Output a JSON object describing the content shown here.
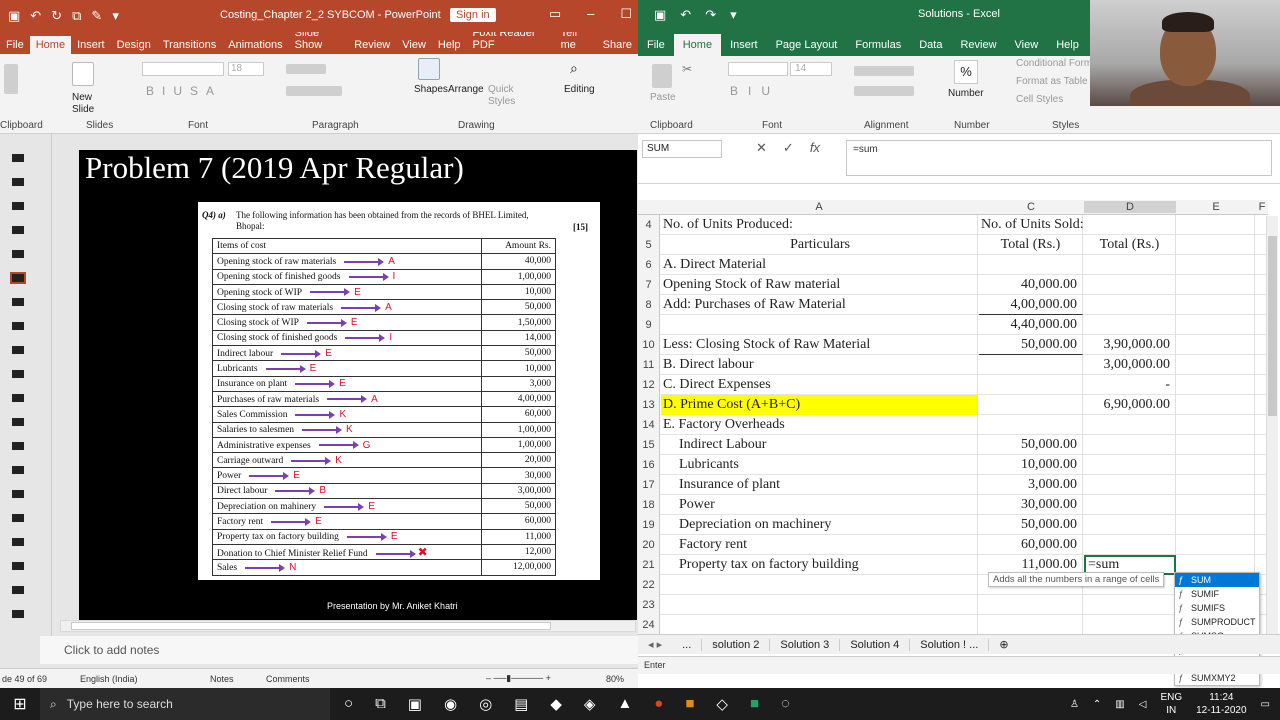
{
  "ppt": {
    "title": "Costing_Chapter 2_2 SYBCOM  -  PowerPoint",
    "signin": "Sign in",
    "tabs": [
      "File",
      "Home",
      "Insert",
      "Design",
      "Transitions",
      "Animations",
      "Slide Show",
      "Review",
      "View",
      "Help",
      "Foxit Reader PDF",
      "Tell me",
      "Share"
    ],
    "groups": [
      "Clipboard",
      "Slides",
      "Font",
      "Paragraph",
      "Drawing"
    ],
    "ribbon": {
      "new_slide": "New Slide",
      "shapes": "Shapes",
      "arrange": "Arrange",
      "quick_styles": "Quick Styles",
      "editing": "Editing",
      "font_size": "18"
    },
    "slide": {
      "title": "Problem 7 (2019 Apr Regular)",
      "question_tag": "Q4)  a)",
      "question_text": "The following information has been obtained from the records of BHEL Limited, Bhopal:",
      "marks": "[15]",
      "table_header": [
        "Items of cost",
        "Amount Rs."
      ],
      "rows": [
        {
          "item": "Opening stock of raw materials",
          "amount": "40,000",
          "cat": "A"
        },
        {
          "item": "Opening stock of finished goods",
          "amount": "1,00,000",
          "cat": "I"
        },
        {
          "item": "Opening stock of WIP",
          "amount": "10,000",
          "cat": "E"
        },
        {
          "item": "Closing stock of raw materials",
          "amount": "50,000",
          "cat": "A"
        },
        {
          "item": "Closing stock of WIP",
          "amount": "1,50,000",
          "cat": "E"
        },
        {
          "item": "Closing stock of finished goods",
          "amount": "14,000",
          "cat": "I"
        },
        {
          "item": "Indirect labour",
          "amount": "50,000",
          "cat": "E"
        },
        {
          "item": "Lubricants",
          "amount": "10,000",
          "cat": "E"
        },
        {
          "item": "Insurance on plant",
          "amount": "3,000",
          "cat": "E"
        },
        {
          "item": "Purchases of raw materials",
          "amount": "4,00,000",
          "cat": "A"
        },
        {
          "item": "Sales Commission",
          "amount": "60,000",
          "cat": "K"
        },
        {
          "item": "Salaries to salesmen",
          "amount": "1,00,000",
          "cat": "K"
        },
        {
          "item": "Administrative expenses",
          "amount": "1,00,000",
          "cat": "G"
        },
        {
          "item": "Carriage outward",
          "amount": "20,000",
          "cat": "K"
        },
        {
          "item": "Power",
          "amount": "30,000",
          "cat": "E"
        },
        {
          "item": "Direct labour",
          "amount": "3,00,000",
          "cat": "B"
        },
        {
          "item": "Depreciation on mahinery",
          "amount": "50,000",
          "cat": "E"
        },
        {
          "item": "Factory rent",
          "amount": "60,000",
          "cat": "E"
        },
        {
          "item": "Property tax on factory building",
          "amount": "11,000",
          "cat": "E"
        },
        {
          "item": "Donation to Chief Minister Relief Fund",
          "amount": "12,000",
          "cat": "✖"
        },
        {
          "item": "Sales",
          "amount": "12,00,000",
          "cat": "N"
        }
      ],
      "footer": "Presentation by Mr. Aniket Khatri"
    },
    "notes_placeholder": "Click to add notes",
    "status": {
      "slide": "de 49 of 69",
      "language": "English (India)",
      "notes": "Notes",
      "comments": "Comments",
      "zoom": "80%"
    }
  },
  "excel": {
    "title": "Solutions  -  Excel",
    "tabs": [
      "File",
      "Home",
      "Insert",
      "Page Layout",
      "Formulas",
      "Data",
      "Review",
      "View",
      "Help"
    ],
    "groups": [
      "Clipboard",
      "Font",
      "Alignment",
      "Number",
      "Styles"
    ],
    "ribbon": {
      "paste": "Paste",
      "font_size": "14",
      "percent": "%",
      "number": "Number",
      "cond_format": "Conditional Form",
      "format_table": "Format as Table",
      "cell_styles": "Cell Styles"
    },
    "name_box": "SUM",
    "formula": "=sum",
    "columns": [
      "A",
      "C",
      "D",
      "E",
      "F"
    ],
    "rows": [
      {
        "n": "4",
        "a": "No. of Units Produced:",
        "c": "No. of Units Sold:",
        "d": ""
      },
      {
        "n": "5",
        "a": "Particulars",
        "c": "Total (Rs.)",
        "d": "Total (Rs.)"
      },
      {
        "n": "6",
        "a": "A. Direct Material",
        "c": "",
        "d": ""
      },
      {
        "n": "7",
        "a": "Opening Stock of Raw material",
        "c": "40,000.00",
        "d": ""
      },
      {
        "n": "8",
        "a": "Add: Purchases of Raw Material",
        "c": "4,00,000.00",
        "d": ""
      },
      {
        "n": "9",
        "a": "",
        "c": "4,40,000.00",
        "d": ""
      },
      {
        "n": "10",
        "a": "Less: Closing Stock of Raw Material",
        "c": "50,000.00",
        "d": "3,90,000.00"
      },
      {
        "n": "11",
        "a": "B. Direct labour",
        "c": "",
        "d": "3,00,000.00"
      },
      {
        "n": "12",
        "a": "C. Direct Expenses",
        "c": "",
        "d": "-"
      },
      {
        "n": "13",
        "a": "D. Prime Cost (A+B+C)",
        "c": "",
        "d": "6,90,000.00"
      },
      {
        "n": "14",
        "a": "E. Factory Overheads",
        "c": "",
        "d": ""
      },
      {
        "n": "15",
        "a": "Indirect Labour",
        "c": "50,000.00",
        "d": ""
      },
      {
        "n": "16",
        "a": "Lubricants",
        "c": "10,000.00",
        "d": ""
      },
      {
        "n": "17",
        "a": "Insurance of plant",
        "c": "3,000.00",
        "d": ""
      },
      {
        "n": "18",
        "a": "Power",
        "c": "30,000.00",
        "d": ""
      },
      {
        "n": "19",
        "a": "Depreciation on machinery",
        "c": "50,000.00",
        "d": ""
      },
      {
        "n": "20",
        "a": "Factory rent",
        "c": "60,000.00",
        "d": ""
      },
      {
        "n": "21",
        "a": "Property tax on factory building",
        "c": "11,000.00",
        "d": "=sum"
      },
      {
        "n": "22",
        "a": "",
        "c": "",
        "d": ""
      },
      {
        "n": "23",
        "a": "",
        "c": "",
        "d": ""
      },
      {
        "n": "24",
        "a": "",
        "c": "",
        "d": ""
      }
    ],
    "tooltip": "Adds all the numbers in a range of cells",
    "autocomplete": [
      "SUM",
      "SUMIF",
      "SUMIFS",
      "SUMPRODUCT",
      "SUMSQ",
      "SUMX2MY2",
      "SUMX2PY2",
      "SUMXMY2"
    ],
    "sheet_tabs": [
      "...",
      "solution 2",
      "Solution 3",
      "Solution 4",
      "Solution ! ..."
    ],
    "status": "Enter"
  },
  "taskbar": {
    "search_placeholder": "Type here to search",
    "lang": "ENG",
    "region": "IN",
    "time": "11:24",
    "date": "12-11-2020"
  },
  "colors": {
    "ppt_accent": "#b7472a",
    "excel_accent": "#217346",
    "highlight": "#ffff00",
    "category_red": "#e0102a",
    "arrow_purple": "#7b3fb0"
  }
}
